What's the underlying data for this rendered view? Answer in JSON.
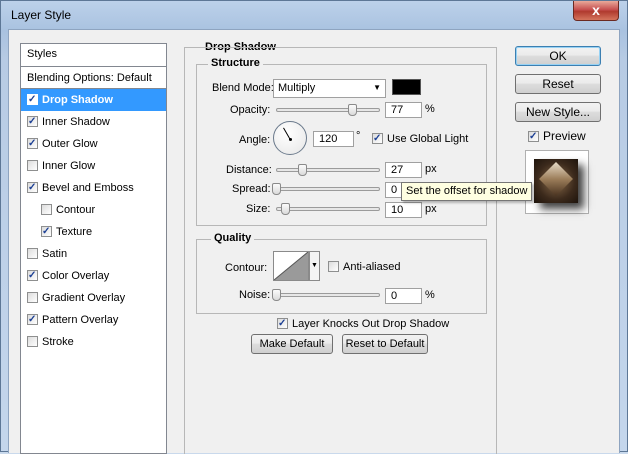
{
  "window": {
    "title": "Layer Style",
    "close_glyph": "x"
  },
  "styles_list": {
    "header": "Styles",
    "blending": "Blending Options: Default",
    "items": [
      {
        "label": "Drop Shadow",
        "checked": true,
        "selected": true,
        "sub": false
      },
      {
        "label": "Inner Shadow",
        "checked": true,
        "selected": false,
        "sub": false
      },
      {
        "label": "Outer Glow",
        "checked": true,
        "selected": false,
        "sub": false
      },
      {
        "label": "Inner Glow",
        "checked": false,
        "selected": false,
        "sub": false
      },
      {
        "label": "Bevel and Emboss",
        "checked": true,
        "selected": false,
        "sub": false
      },
      {
        "label": "Contour",
        "checked": false,
        "selected": false,
        "sub": true
      },
      {
        "label": "Texture",
        "checked": true,
        "selected": false,
        "sub": true
      },
      {
        "label": "Satin",
        "checked": false,
        "selected": false,
        "sub": false
      },
      {
        "label": "Color Overlay",
        "checked": true,
        "selected": false,
        "sub": false
      },
      {
        "label": "Gradient Overlay",
        "checked": false,
        "selected": false,
        "sub": false
      },
      {
        "label": "Pattern Overlay",
        "checked": true,
        "selected": false,
        "sub": false
      },
      {
        "label": "Stroke",
        "checked": false,
        "selected": false,
        "sub": false
      }
    ]
  },
  "drop_shadow": {
    "section_title": "Drop Shadow",
    "structure": {
      "title": "Structure",
      "blend_mode_label": "Blend Mode:",
      "blend_mode_value": "Multiply",
      "shadow_color": "#000000",
      "opacity_label": "Opacity:",
      "opacity_value": "77",
      "opacity_fraction": 0.77,
      "percent": "%",
      "angle_label": "Angle:",
      "angle_value": "120",
      "degree": "°",
      "use_global_light_label": "Use Global Light",
      "use_global_light_checked": true,
      "distance_label": "Distance:",
      "distance_value": "27",
      "px": "px",
      "spread_label": "Spread:",
      "spread_value": "0",
      "size_label": "Size:",
      "size_value": "10"
    },
    "quality": {
      "title": "Quality",
      "contour_label": "Contour:",
      "anti_aliased_label": "Anti-aliased",
      "anti_aliased_checked": false,
      "noise_label": "Noise:",
      "noise_value": "0",
      "percent": "%"
    },
    "knocks_out_label": "Layer Knocks Out Drop Shadow",
    "knocks_out_checked": true,
    "make_default": "Make Default",
    "reset_default": "Reset to Default"
  },
  "tooltip": "Set the offset for shadow",
  "buttons": {
    "ok": "OK",
    "reset": "Reset",
    "new_style": "New Style..."
  },
  "preview": {
    "label": "Preview",
    "checked": true
  }
}
